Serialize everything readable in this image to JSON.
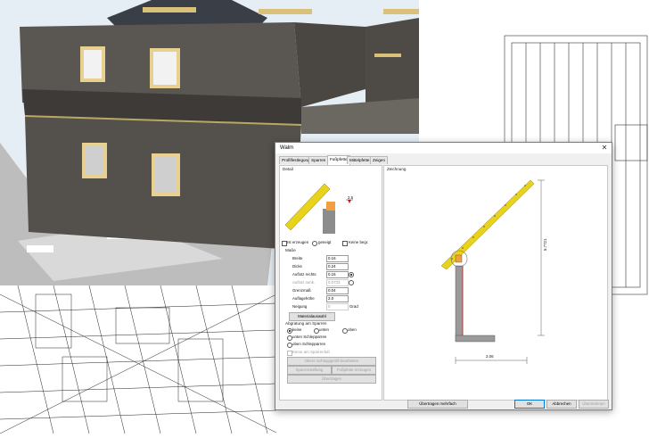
{
  "dialog": {
    "title": "Walm",
    "tabs": [
      {
        "label": "Profilfestlegung",
        "active": false
      },
      {
        "label": "Sparren",
        "active": false
      },
      {
        "label": "Fußpfette",
        "active": true
      },
      {
        "label": "Mittelpfette",
        "active": false
      },
      {
        "label": "Zeigen",
        "active": false
      }
    ],
    "detail": {
      "label": "Detail",
      "annotation": "2.5"
    },
    "options": {
      "erzeugen": "Ist erzeugen",
      "geneigt": "geneigt",
      "keine_bege": "Keine begr."
    },
    "masse": {
      "label": "Maße",
      "fields": [
        {
          "label": "Breite",
          "value": "0.16",
          "enabled": true
        },
        {
          "label": "Dicke",
          "value": "0.24",
          "enabled": true
        },
        {
          "label": "Auflotz rechts",
          "value": "0.16",
          "enabled": true
        },
        {
          "label": "Auflotz senk.",
          "value": "0.0733",
          "enabled": false
        },
        {
          "label": "Grenzmaß",
          "value": "0.04",
          "enabled": true
        },
        {
          "label": "Auflagehöhe",
          "value": "2.0",
          "enabled": true
        },
        {
          "label": "Neigung",
          "value": "0",
          "enabled": false
        }
      ],
      "unit_grad": "Grad"
    },
    "materialauswahl": "Materialauswahl",
    "abgratung": {
      "label": "Abgratung am Sparren",
      "opts": [
        {
          "label": "keine",
          "checked": true
        },
        {
          "label": "unten",
          "checked": false
        },
        {
          "label": "oben",
          "checked": false
        },
        {
          "label": "unten Schlepparren",
          "checked": false
        },
        {
          "label": "oben Schlepparren",
          "checked": false
        }
      ]
    },
    "grey_checkbox": "Kerve am Sparrenfuß",
    "disabled_buttons": [
      "Obere Schleppprofil bearbeiten",
      "Sparrenstellung",
      "Fußpfette erzeugen",
      "Übertragen"
    ],
    "zeichnung": {
      "label": "Zeichnung",
      "dim_vertical": "5.7721",
      "dim_horizontal": "2.06"
    },
    "footer": {
      "uebertragen": "Übertragen mehrfach",
      "ok": "OK",
      "abbrechen": "Abbrechen",
      "uebernehmen": "Übernehmen"
    }
  },
  "colors": {
    "accent": "#0078d7",
    "rafter_yellow": "#e8d21a",
    "plate_orange": "#f0a040",
    "wall_gray": "#5a5752",
    "marker_red": "#d21c1c"
  }
}
